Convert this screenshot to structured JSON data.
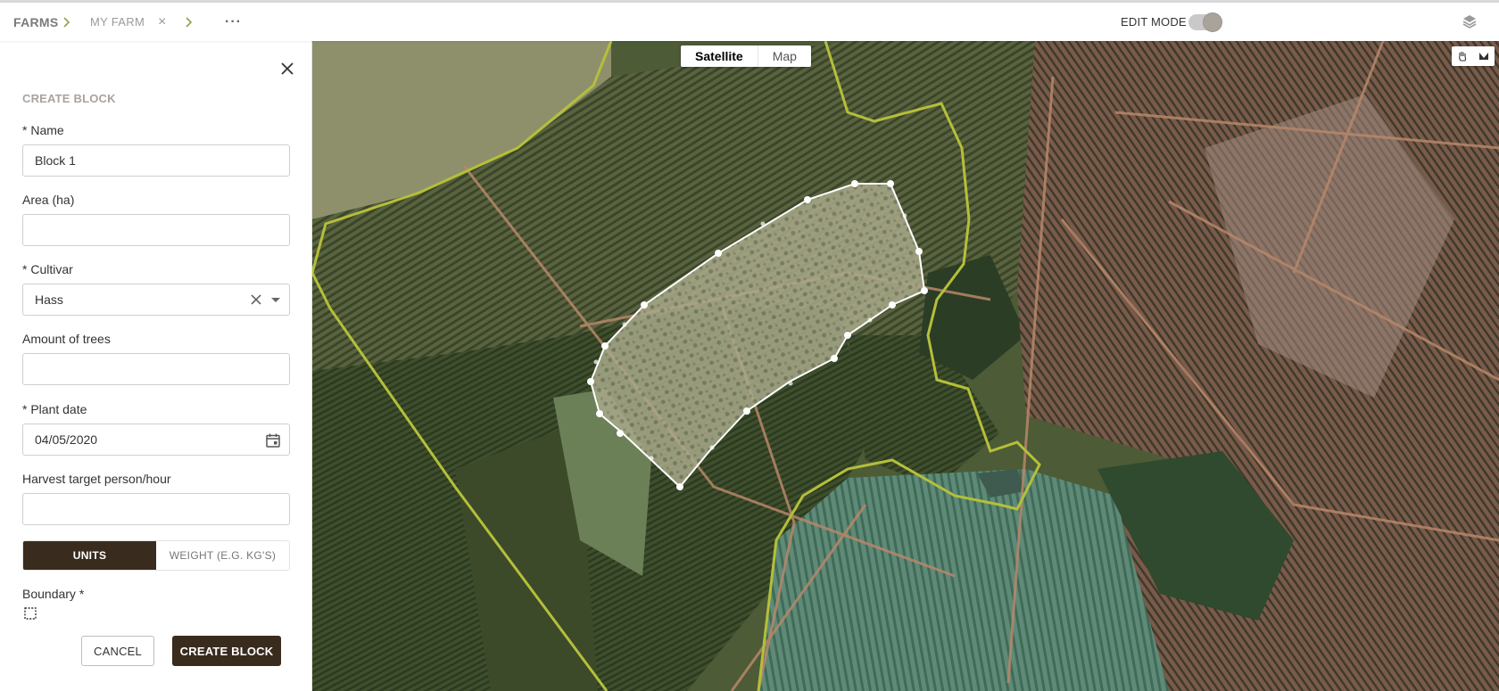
{
  "header": {
    "breadcrumb_root": "FARMS",
    "breadcrumb_sep": ">",
    "breadcrumb_current": "MY FARM",
    "breadcrumb_close": "×",
    "more": "···",
    "edit_mode_label": "EDIT MODE",
    "edit_mode_on": true
  },
  "panel": {
    "title": "CREATE BLOCK",
    "name_label": "* Name",
    "name_value": "Block 1",
    "area_label": "Area (ha)",
    "area_value": "",
    "cultivar_label": "* Cultivar",
    "cultivar_value": "Hass",
    "trees_label": "Amount of trees",
    "trees_value": "",
    "plant_date_label": "* Plant date",
    "plant_date_value": "04/05/2020",
    "harvest_label": "Harvest target person/hour",
    "harvest_value": "",
    "unit_option_units": "UNITS",
    "unit_option_weight": "WEIGHT (E.G. KG'S)",
    "unit_selected": "UNITS",
    "boundary_label": "Boundary *",
    "cancel_label": "CANCEL",
    "create_label": "CREATE BLOCK"
  },
  "map": {
    "type_satellite": "Satellite",
    "type_map": "Map",
    "type_selected": "Satellite",
    "boundary_color": "#b5bf3a",
    "selection_color": "#ffffff",
    "icons": [
      "hand-pan-icon",
      "draw-polygon-icon"
    ]
  },
  "colors": {
    "accent_dark": "#3a2b1f",
    "breadcrumb_sep": "#8fa24b"
  }
}
